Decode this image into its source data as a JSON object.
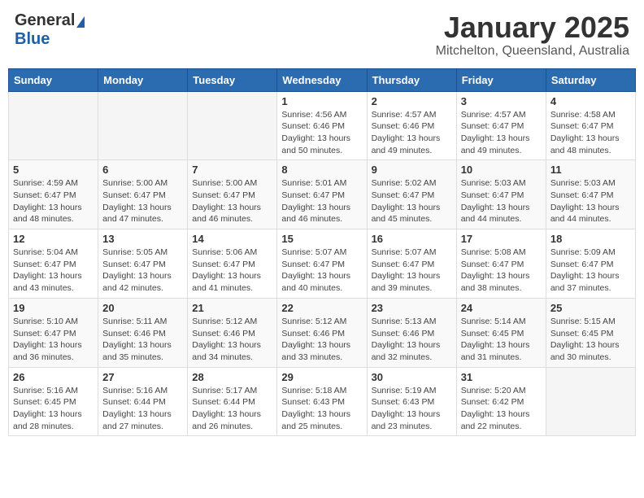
{
  "header": {
    "logo_general": "General",
    "logo_blue": "Blue",
    "title": "January 2025",
    "subtitle": "Mitchelton, Queensland, Australia"
  },
  "days_of_week": [
    "Sunday",
    "Monday",
    "Tuesday",
    "Wednesday",
    "Thursday",
    "Friday",
    "Saturday"
  ],
  "weeks": [
    [
      {
        "day": "",
        "detail": ""
      },
      {
        "day": "",
        "detail": ""
      },
      {
        "day": "",
        "detail": ""
      },
      {
        "day": "1",
        "detail": "Sunrise: 4:56 AM\nSunset: 6:46 PM\nDaylight: 13 hours\nand 50 minutes."
      },
      {
        "day": "2",
        "detail": "Sunrise: 4:57 AM\nSunset: 6:46 PM\nDaylight: 13 hours\nand 49 minutes."
      },
      {
        "day": "3",
        "detail": "Sunrise: 4:57 AM\nSunset: 6:47 PM\nDaylight: 13 hours\nand 49 minutes."
      },
      {
        "day": "4",
        "detail": "Sunrise: 4:58 AM\nSunset: 6:47 PM\nDaylight: 13 hours\nand 48 minutes."
      }
    ],
    [
      {
        "day": "5",
        "detail": "Sunrise: 4:59 AM\nSunset: 6:47 PM\nDaylight: 13 hours\nand 48 minutes."
      },
      {
        "day": "6",
        "detail": "Sunrise: 5:00 AM\nSunset: 6:47 PM\nDaylight: 13 hours\nand 47 minutes."
      },
      {
        "day": "7",
        "detail": "Sunrise: 5:00 AM\nSunset: 6:47 PM\nDaylight: 13 hours\nand 46 minutes."
      },
      {
        "day": "8",
        "detail": "Sunrise: 5:01 AM\nSunset: 6:47 PM\nDaylight: 13 hours\nand 46 minutes."
      },
      {
        "day": "9",
        "detail": "Sunrise: 5:02 AM\nSunset: 6:47 PM\nDaylight: 13 hours\nand 45 minutes."
      },
      {
        "day": "10",
        "detail": "Sunrise: 5:03 AM\nSunset: 6:47 PM\nDaylight: 13 hours\nand 44 minutes."
      },
      {
        "day": "11",
        "detail": "Sunrise: 5:03 AM\nSunset: 6:47 PM\nDaylight: 13 hours\nand 44 minutes."
      }
    ],
    [
      {
        "day": "12",
        "detail": "Sunrise: 5:04 AM\nSunset: 6:47 PM\nDaylight: 13 hours\nand 43 minutes."
      },
      {
        "day": "13",
        "detail": "Sunrise: 5:05 AM\nSunset: 6:47 PM\nDaylight: 13 hours\nand 42 minutes."
      },
      {
        "day": "14",
        "detail": "Sunrise: 5:06 AM\nSunset: 6:47 PM\nDaylight: 13 hours\nand 41 minutes."
      },
      {
        "day": "15",
        "detail": "Sunrise: 5:07 AM\nSunset: 6:47 PM\nDaylight: 13 hours\nand 40 minutes."
      },
      {
        "day": "16",
        "detail": "Sunrise: 5:07 AM\nSunset: 6:47 PM\nDaylight: 13 hours\nand 39 minutes."
      },
      {
        "day": "17",
        "detail": "Sunrise: 5:08 AM\nSunset: 6:47 PM\nDaylight: 13 hours\nand 38 minutes."
      },
      {
        "day": "18",
        "detail": "Sunrise: 5:09 AM\nSunset: 6:47 PM\nDaylight: 13 hours\nand 37 minutes."
      }
    ],
    [
      {
        "day": "19",
        "detail": "Sunrise: 5:10 AM\nSunset: 6:47 PM\nDaylight: 13 hours\nand 36 minutes."
      },
      {
        "day": "20",
        "detail": "Sunrise: 5:11 AM\nSunset: 6:46 PM\nDaylight: 13 hours\nand 35 minutes."
      },
      {
        "day": "21",
        "detail": "Sunrise: 5:12 AM\nSunset: 6:46 PM\nDaylight: 13 hours\nand 34 minutes."
      },
      {
        "day": "22",
        "detail": "Sunrise: 5:12 AM\nSunset: 6:46 PM\nDaylight: 13 hours\nand 33 minutes."
      },
      {
        "day": "23",
        "detail": "Sunrise: 5:13 AM\nSunset: 6:46 PM\nDaylight: 13 hours\nand 32 minutes."
      },
      {
        "day": "24",
        "detail": "Sunrise: 5:14 AM\nSunset: 6:45 PM\nDaylight: 13 hours\nand 31 minutes."
      },
      {
        "day": "25",
        "detail": "Sunrise: 5:15 AM\nSunset: 6:45 PM\nDaylight: 13 hours\nand 30 minutes."
      }
    ],
    [
      {
        "day": "26",
        "detail": "Sunrise: 5:16 AM\nSunset: 6:45 PM\nDaylight: 13 hours\nand 28 minutes."
      },
      {
        "day": "27",
        "detail": "Sunrise: 5:16 AM\nSunset: 6:44 PM\nDaylight: 13 hours\nand 27 minutes."
      },
      {
        "day": "28",
        "detail": "Sunrise: 5:17 AM\nSunset: 6:44 PM\nDaylight: 13 hours\nand 26 minutes."
      },
      {
        "day": "29",
        "detail": "Sunrise: 5:18 AM\nSunset: 6:43 PM\nDaylight: 13 hours\nand 25 minutes."
      },
      {
        "day": "30",
        "detail": "Sunrise: 5:19 AM\nSunset: 6:43 PM\nDaylight: 13 hours\nand 23 minutes."
      },
      {
        "day": "31",
        "detail": "Sunrise: 5:20 AM\nSunset: 6:42 PM\nDaylight: 13 hours\nand 22 minutes."
      },
      {
        "day": "",
        "detail": ""
      }
    ]
  ]
}
